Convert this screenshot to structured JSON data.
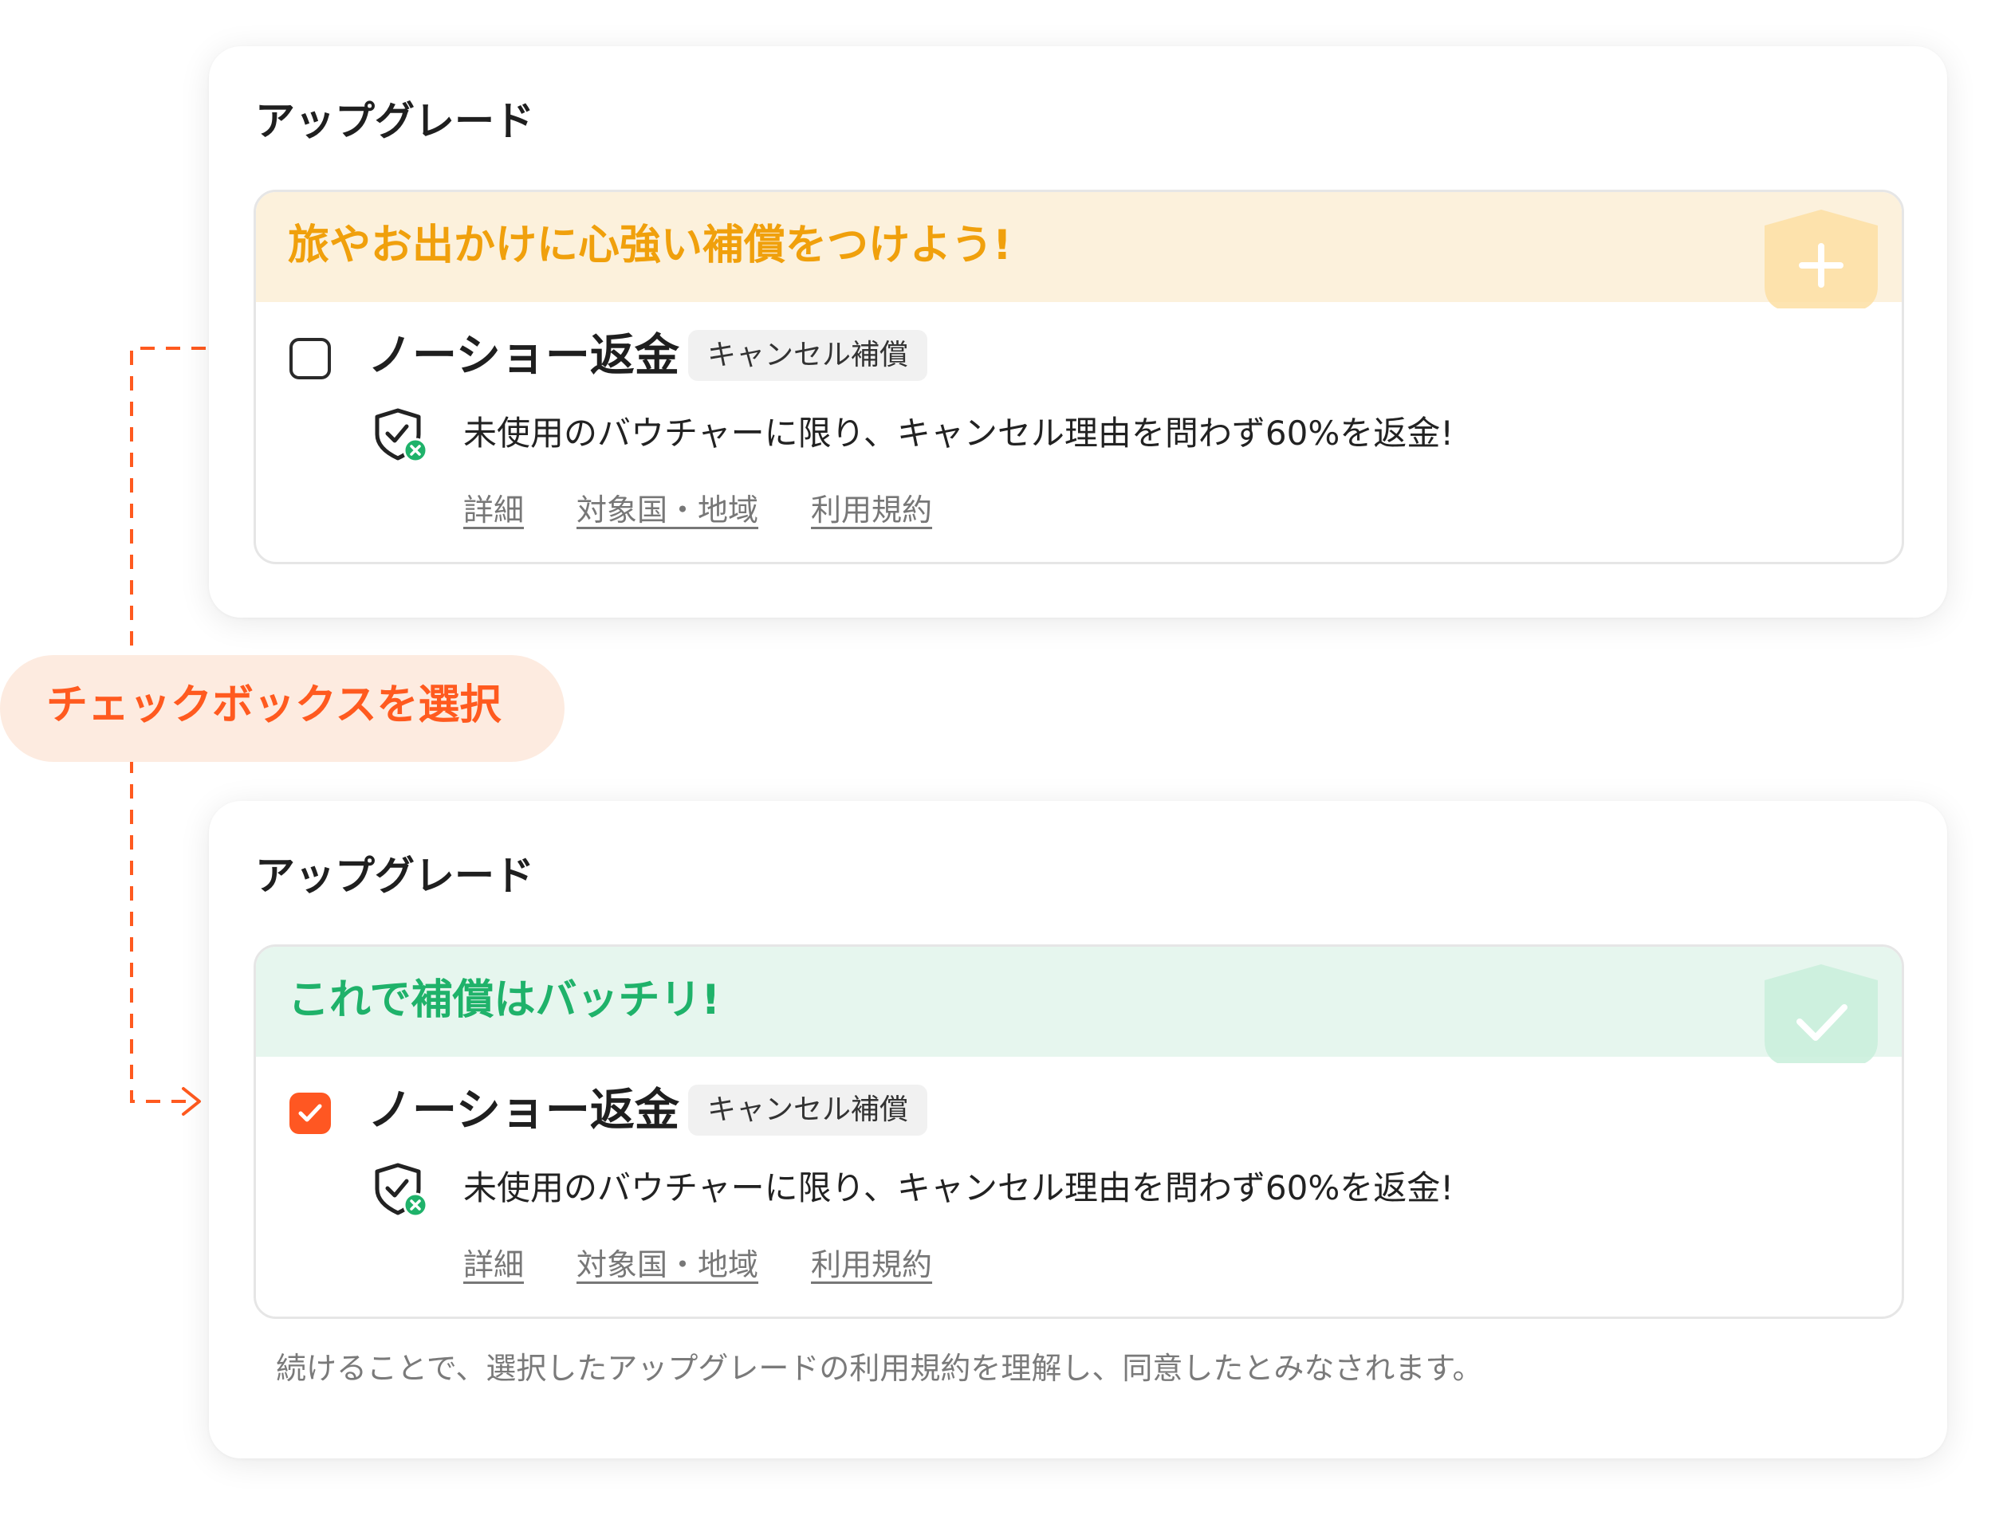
{
  "step_label": "チェックボックスを選択",
  "card_before": {
    "title": "アップグレード",
    "header_text": "旅やお出かけに心強い補償をつけよう!",
    "checkbox_checked": false,
    "product_name": "ノーショー返金",
    "badge": "キャンセル補償",
    "feature_text": "未使用のバウチャーに限り、キャンセル理由を問わず60%を返金!",
    "links": [
      "詳細",
      "対象国・地域",
      "利用規約"
    ],
    "header_icon": "shield-plus-icon",
    "accent_color": "#f0a00c"
  },
  "card_after": {
    "title": "アップグレード",
    "header_text": "これで補償はバッチリ!",
    "checkbox_checked": true,
    "product_name": "ノーショー返金",
    "badge": "キャンセル補償",
    "feature_text": "未使用のバウチャーに限り、キャンセル理由を問わず60%を返金!",
    "links": [
      "詳細",
      "対象国・地域",
      "利用規約"
    ],
    "header_icon": "shield-check-icon",
    "accent_color": "#1fb26a",
    "disclaimer": "続けることで、選択したアップグレードの利用規約を理解し、同意したとみなされます。"
  },
  "colors": {
    "checkbox_checked": "#ff5722",
    "connector": "#ff5a1f"
  }
}
